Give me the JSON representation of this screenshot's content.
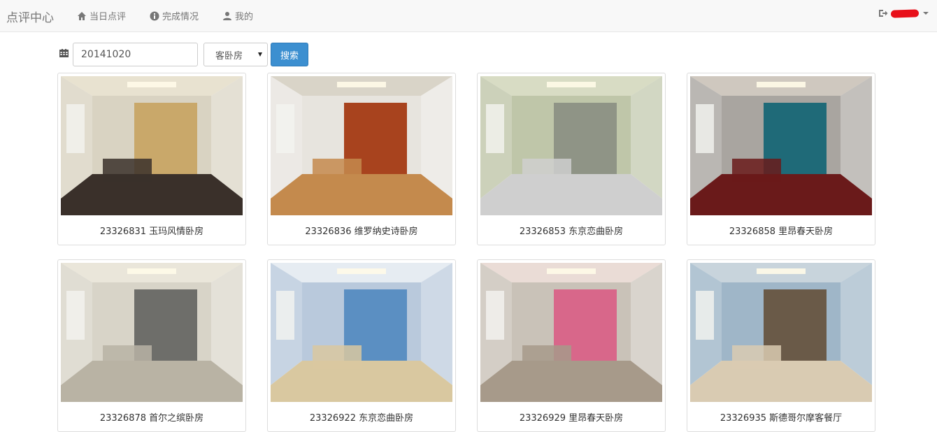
{
  "navbar": {
    "brand": "点评中心",
    "items": [
      {
        "label": "当日点评",
        "icon": "home-icon"
      },
      {
        "label": "完成情况",
        "icon": "info-circle-icon"
      },
      {
        "label": "我的",
        "icon": "user-icon"
      }
    ],
    "user_menu_icon": "logout-icon"
  },
  "search": {
    "date_value": "20141020",
    "room_type": "客卧房",
    "button_label": "搜索"
  },
  "cards": [
    {
      "caption": "23326831 玉玛风情卧房",
      "palette": [
        "#d9d3c2",
        "#c9a86a",
        "#3a302a",
        "#e8e2d0"
      ]
    },
    {
      "caption": "23326836 维罗纳史诗卧房",
      "palette": [
        "#e7e4de",
        "#a8431e",
        "#c48a4d",
        "#d9d4c8"
      ]
    },
    {
      "caption": "23326853 东京恋曲卧房",
      "palette": [
        "#bfc6a9",
        "#8f9486",
        "#cfcfcf",
        "#d8dcc4"
      ]
    },
    {
      "caption": "23326858 里昂春天卧房",
      "palette": [
        "#a9a5a0",
        "#1f6a78",
        "#6a1a1a",
        "#cfc8bf"
      ]
    },
    {
      "caption": "23326878 首尔之缤卧房",
      "palette": [
        "#d8d4c8",
        "#6e6e6a",
        "#b9b3a4",
        "#eae6da"
      ]
    },
    {
      "caption": "23326922 东京恋曲卧房",
      "palette": [
        "#b9c9dc",
        "#5b8fc2",
        "#d9c8a0",
        "#e6ecf2"
      ]
    },
    {
      "caption": "23326929 里昂春天卧房",
      "palette": [
        "#c9c2b8",
        "#d8678a",
        "#a79a8a",
        "#eadcd6"
      ]
    },
    {
      "caption": "23326935 斯德哥尔摩客餐厅",
      "palette": [
        "#9fb6c8",
        "#6a5a48",
        "#d9cbb2",
        "#c8d4dc"
      ]
    }
  ]
}
